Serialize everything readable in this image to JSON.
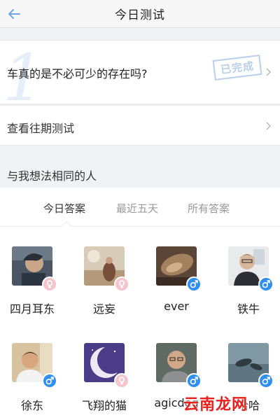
{
  "header": {
    "title": "今日测试"
  },
  "test": {
    "number": "1",
    "question": "车真的是不必可少的存在吗?",
    "status": "已完成"
  },
  "history": {
    "label": "查看往期测试"
  },
  "section": {
    "title": "与我想法相同的人"
  },
  "tabs": [
    {
      "label": "今日答案",
      "active": true
    },
    {
      "label": "最近五天",
      "active": false
    },
    {
      "label": "所有答案",
      "active": false
    }
  ],
  "users": [
    {
      "name": "四月耳东",
      "gender": "female"
    },
    {
      "name": "远妄",
      "gender": "female"
    },
    {
      "name": "ever",
      "gender": "male"
    },
    {
      "name": "铁牛",
      "gender": "male"
    },
    {
      "name": "徐东",
      "gender": "male"
    },
    {
      "name": "飞翔的猫",
      "gender": "female"
    },
    {
      "name": "agicdeg",
      "gender": "male"
    },
    {
      "name": "哈哈",
      "gender": "male"
    }
  ],
  "watermark": "云南龙网",
  "colors": {
    "accent": "#2f8ff3",
    "female": "#f6c4cc",
    "stamp": "#b9cfea",
    "back": "#6fa6de"
  }
}
